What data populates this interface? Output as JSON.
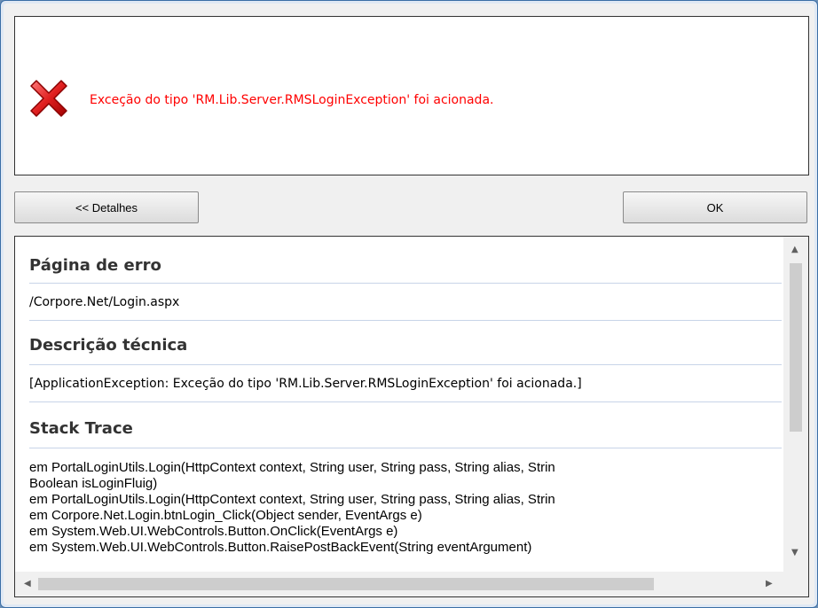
{
  "message": {
    "icon": "error-x-icon",
    "text": "Exceção do tipo 'RM.Lib.Server.RMSLoginException' foi acionada.",
    "color": "#ff0000"
  },
  "buttons": {
    "details_label": "<< Detalhes",
    "ok_label": "OK"
  },
  "details": {
    "page_heading": "Página de erro",
    "page_value": "/Corpore.Net/Login.aspx",
    "tech_heading": "Descrição técnica",
    "tech_value": "[ApplicationException: Exceção do tipo 'RM.Lib.Server.RMSLoginException' foi acionada.]",
    "trace_heading": "Stack Trace",
    "trace_lines": [
      "em PortalLoginUtils.Login(HttpContext context, String user, String pass, String alias, Strin",
      "Boolean isLoginFluig)",
      "em PortalLoginUtils.Login(HttpContext context, String user, String pass, String alias, Strin",
      "em Corpore.Net.Login.btnLogin_Click(Object sender, EventArgs e)",
      "em System.Web.UI.WebControls.Button.OnClick(EventArgs e)",
      "em System.Web.UI.WebControls.Button.RaisePostBackEvent(String eventArgument)"
    ]
  }
}
